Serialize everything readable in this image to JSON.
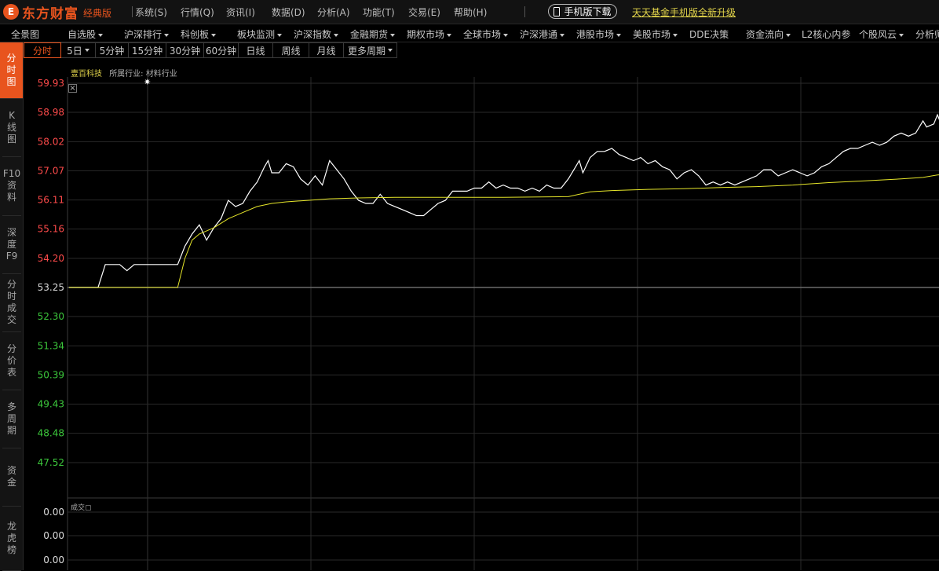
{
  "app": {
    "logo_mark": "E",
    "logo_text": "东方财富",
    "edition": "经典版"
  },
  "top_menu": [
    {
      "label": "系统(S)"
    },
    {
      "label": "行情(Q)"
    },
    {
      "label": "资讯(I)"
    },
    {
      "label": "数据(D)"
    },
    {
      "label": "分析(A)"
    },
    {
      "label": "功能(T)"
    },
    {
      "label": "交易(E)"
    },
    {
      "label": "帮助(H)"
    }
  ],
  "mobile_button": "手机版下载",
  "fund_link": "天天基金手机版全新升级",
  "nav": [
    {
      "label": "全景图",
      "dropdown": false
    },
    {
      "label": "自选股",
      "dropdown": true
    },
    {
      "label": "沪深排行",
      "dropdown": true
    },
    {
      "label": "科创板",
      "dropdown": true
    },
    {
      "label": "板块监测",
      "dropdown": true
    },
    {
      "label": "沪深指数",
      "dropdown": true
    },
    {
      "label": "金融期货",
      "dropdown": true
    },
    {
      "label": "期权市场",
      "dropdown": true
    },
    {
      "label": "全球市场",
      "dropdown": true
    },
    {
      "label": "沪深港通",
      "dropdown": true
    },
    {
      "label": "港股市场",
      "dropdown": true
    },
    {
      "label": "美股市场",
      "dropdown": true
    },
    {
      "label": "DDE决策",
      "dropdown": false
    },
    {
      "label": "资金流向",
      "dropdown": true
    },
    {
      "label": "L2核心内参",
      "dropdown": false
    },
    {
      "label": "个股风云",
      "dropdown": true
    },
    {
      "label": "分析师",
      "dropdown": false
    }
  ],
  "side_tabs": [
    {
      "label": "分时图",
      "active": true
    },
    {
      "label": "K线图",
      "active": false
    },
    {
      "label": "F10资料",
      "active": false
    },
    {
      "label": "深度F9",
      "active": false
    },
    {
      "label": "分时成交",
      "active": false
    },
    {
      "label": "分价表",
      "active": false
    },
    {
      "label": "多周期",
      "active": false
    },
    {
      "label": "资金",
      "active": false
    },
    {
      "label": "龙虎榜",
      "active": false
    }
  ],
  "periods": [
    {
      "label": "分时",
      "active": true,
      "dropdown": false
    },
    {
      "label": "5日",
      "active": false,
      "dropdown": true
    },
    {
      "label": "5分钟",
      "active": false,
      "dropdown": false
    },
    {
      "label": "15分钟",
      "active": false,
      "dropdown": false
    },
    {
      "label": "30分钟",
      "active": false,
      "dropdown": false
    },
    {
      "label": "60分钟",
      "active": false,
      "dropdown": false
    },
    {
      "label": "日线",
      "active": false,
      "dropdown": false
    },
    {
      "label": "周线",
      "active": false,
      "dropdown": false
    },
    {
      "label": "月线",
      "active": false,
      "dropdown": false
    },
    {
      "label": "更多周期",
      "active": false,
      "dropdown": true
    }
  ],
  "stock": {
    "name": "壹百科技",
    "industry_label": "所属行业:",
    "industry": "材料行业"
  },
  "volume_label": "成交",
  "colors": {
    "accent": "#e8541e",
    "up": "#ff4b4b",
    "down": "#3cc83c",
    "neutral": "#dcdcdc",
    "price_line": "#ffffff",
    "avg_line": "#e6e62a",
    "grid": "#2a2a2a"
  },
  "icons": {
    "close": "close-icon",
    "crosshair": "star-icon",
    "phone": "phone-icon"
  },
  "chart_data": {
    "type": "line",
    "prev_close": 53.25,
    "y_ticks": [
      "59.93",
      "58.98",
      "58.02",
      "57.07",
      "56.11",
      "55.16",
      "54.20",
      "53.25",
      "52.30",
      "51.34",
      "50.39",
      "49.43",
      "48.48",
      "47.52"
    ],
    "ylim": [
      46.57,
      59.93
    ],
    "volume_ticks": [
      "0.00",
      "0.00",
      "0.00"
    ],
    "total_minutes": 240,
    "series": [
      {
        "points": [
          [
            0,
            53.25
          ],
          [
            8,
            53.25
          ],
          [
            10,
            54.0
          ],
          [
            14,
            54.0
          ],
          [
            16,
            53.8
          ],
          [
            18,
            54.0
          ],
          [
            22,
            54.0
          ],
          [
            26,
            54.0
          ],
          [
            30,
            54.0
          ],
          [
            32,
            54.6
          ],
          [
            34,
            55.0
          ],
          [
            36,
            55.3
          ],
          [
            38,
            54.8
          ],
          [
            40,
            55.2
          ],
          [
            42,
            55.5
          ],
          [
            44,
            56.1
          ],
          [
            46,
            55.9
          ],
          [
            48,
            56.0
          ],
          [
            50,
            56.4
          ],
          [
            52,
            56.7
          ],
          [
            54,
            57.2
          ],
          [
            55,
            57.4
          ],
          [
            56,
            57.0
          ],
          [
            58,
            57.0
          ],
          [
            60,
            57.3
          ],
          [
            62,
            57.2
          ],
          [
            64,
            56.8
          ],
          [
            66,
            56.6
          ],
          [
            68,
            56.9
          ],
          [
            70,
            56.6
          ],
          [
            72,
            57.4
          ],
          [
            74,
            57.1
          ],
          [
            76,
            56.8
          ],
          [
            78,
            56.4
          ],
          [
            80,
            56.1
          ],
          [
            82,
            56.0
          ],
          [
            84,
            56.0
          ],
          [
            86,
            56.3
          ],
          [
            88,
            56.0
          ],
          [
            90,
            55.9
          ],
          [
            92,
            55.8
          ],
          [
            94,
            55.7
          ],
          [
            96,
            55.6
          ],
          [
            98,
            55.6
          ],
          [
            100,
            55.8
          ],
          [
            102,
            56.0
          ],
          [
            104,
            56.1
          ],
          [
            106,
            56.4
          ],
          [
            108,
            56.4
          ],
          [
            110,
            56.4
          ],
          [
            112,
            56.5
          ],
          [
            114,
            56.5
          ],
          [
            116,
            56.7
          ],
          [
            118,
            56.5
          ],
          [
            120,
            56.6
          ],
          [
            122,
            56.5
          ],
          [
            124,
            56.5
          ],
          [
            126,
            56.4
          ],
          [
            128,
            56.5
          ],
          [
            130,
            56.4
          ],
          [
            132,
            56.6
          ],
          [
            134,
            56.5
          ],
          [
            136,
            56.5
          ],
          [
            138,
            56.8
          ],
          [
            140,
            57.2
          ],
          [
            141,
            57.4
          ],
          [
            142,
            57.0
          ],
          [
            144,
            57.5
          ],
          [
            146,
            57.7
          ],
          [
            148,
            57.7
          ],
          [
            150,
            57.8
          ],
          [
            152,
            57.6
          ],
          [
            154,
            57.5
          ],
          [
            156,
            57.4
          ],
          [
            158,
            57.5
          ],
          [
            160,
            57.3
          ],
          [
            162,
            57.4
          ],
          [
            164,
            57.2
          ],
          [
            166,
            57.1
          ],
          [
            168,
            56.8
          ],
          [
            170,
            57.0
          ],
          [
            172,
            57.1
          ],
          [
            174,
            56.9
          ],
          [
            176,
            56.6
          ],
          [
            178,
            56.7
          ],
          [
            180,
            56.6
          ],
          [
            182,
            56.7
          ],
          [
            184,
            56.6
          ],
          [
            186,
            56.7
          ],
          [
            188,
            56.8
          ],
          [
            190,
            56.9
          ],
          [
            192,
            57.1
          ],
          [
            194,
            57.1
          ],
          [
            196,
            56.9
          ],
          [
            198,
            57.0
          ],
          [
            200,
            57.1
          ],
          [
            202,
            57.0
          ],
          [
            204,
            56.9
          ],
          [
            206,
            57.0
          ],
          [
            208,
            57.2
          ],
          [
            210,
            57.3
          ],
          [
            212,
            57.5
          ],
          [
            214,
            57.7
          ],
          [
            216,
            57.8
          ],
          [
            218,
            57.8
          ],
          [
            220,
            57.9
          ],
          [
            222,
            58.0
          ],
          [
            224,
            57.9
          ],
          [
            226,
            58.0
          ],
          [
            228,
            58.2
          ],
          [
            230,
            58.3
          ],
          [
            232,
            58.2
          ],
          [
            234,
            58.3
          ],
          [
            236,
            58.7
          ],
          [
            237,
            58.5
          ],
          [
            239,
            58.6
          ],
          [
            240,
            58.9
          ],
          [
            241,
            58.6
          ],
          [
            242,
            58.8
          ]
        ]
      },
      {
        "points": [
          [
            0,
            53.25
          ],
          [
            30,
            53.25
          ],
          [
            32,
            54.2
          ],
          [
            34,
            54.8
          ],
          [
            36,
            55.0
          ],
          [
            40,
            55.2
          ],
          [
            44,
            55.5
          ],
          [
            48,
            55.7
          ],
          [
            52,
            55.9
          ],
          [
            56,
            56.0
          ],
          [
            60,
            56.05
          ],
          [
            66,
            56.1
          ],
          [
            72,
            56.15
          ],
          [
            80,
            56.18
          ],
          [
            90,
            56.2
          ],
          [
            100,
            56.2
          ],
          [
            120,
            56.2
          ],
          [
            138,
            56.22
          ],
          [
            144,
            56.38
          ],
          [
            150,
            56.42
          ],
          [
            160,
            56.46
          ],
          [
            170,
            56.48
          ],
          [
            180,
            56.52
          ],
          [
            190,
            56.55
          ],
          [
            200,
            56.6
          ],
          [
            210,
            56.68
          ],
          [
            220,
            56.74
          ],
          [
            230,
            56.8
          ],
          [
            236,
            56.85
          ],
          [
            240,
            56.93
          ],
          [
            242,
            56.95
          ]
        ]
      }
    ]
  }
}
